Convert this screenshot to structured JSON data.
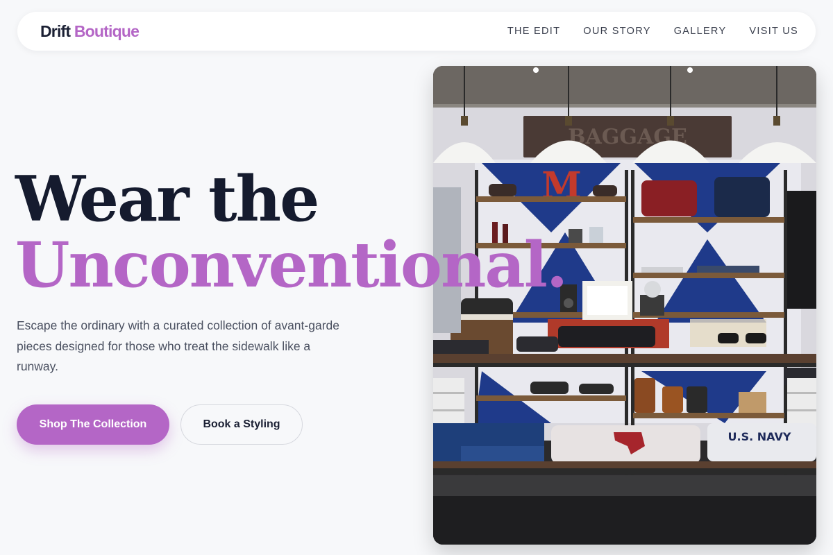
{
  "nav": {
    "logo_main": "Drift",
    "logo_accent": "Boutique",
    "links": [
      "THE EDIT",
      "OUR STORY",
      "GALLERY",
      "VISIT US"
    ]
  },
  "hero": {
    "headline_line1": "Wear the",
    "headline_line2": "Unconventional.",
    "subtext": "Escape the ordinary with a curated collection of avant-garde pieces designed for those who treat the sidewalk like a runway.",
    "primary_cta": "Shop The Collection",
    "secondary_cta": "Book a Styling"
  },
  "photo": {
    "shop_sign": "BAGGAGE",
    "tag_text": "U.S. NAVY"
  },
  "colors": {
    "accent": "#b466c6",
    "dark": "#151b2e",
    "background": "#f7f8fa"
  }
}
